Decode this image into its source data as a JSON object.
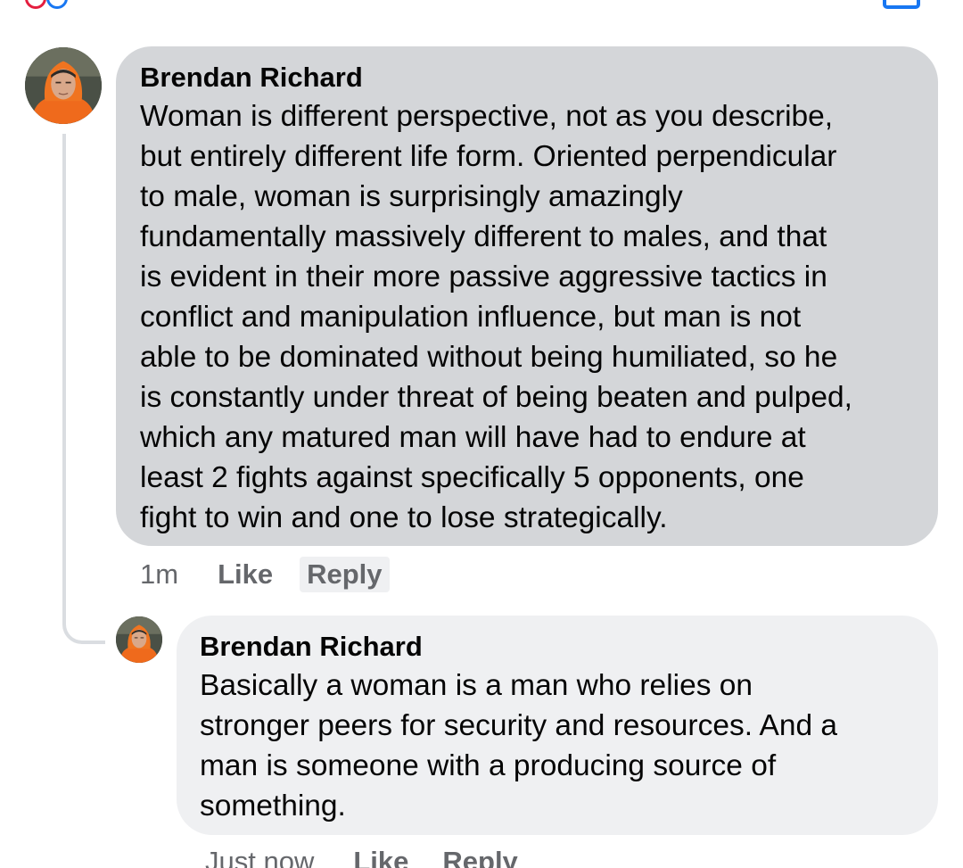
{
  "comments": [
    {
      "author": "Brendan Richard",
      "text": "Woman is different perspective, not as you describe,\nbut entirely different life form. Oriented perpendicular\nto male, woman is surprisingly amazingly\nfundamentally massively different to males, and that\nis evident in their more passive aggressive tactics in\nconflict and manipulation influence, but man is not\nable to be dominated without being humiliated, so he\nis constantly under threat of being beaten and pulped,\nwhich any matured man will have had to endure at\nleast 2 fights against specifically 5 opponents, one\nfight to win and one to lose strategically.",
      "time": "1m",
      "like_label": "Like",
      "reply_label": "Reply"
    },
    {
      "author": "Brendan Richard",
      "text": "Basically a woman is a man who relies on\nstronger peers for security and resources. And a\nman is someone with a producing source of\nsomething.",
      "time": "Just now",
      "like_label": "Like",
      "reply_label": "Reply"
    }
  ],
  "icons": {
    "avatar": "profile-photo-orange-hoodie",
    "top_right": "compose-icon"
  },
  "colors": {
    "main_bubble": "#d4d6d9",
    "reply_bubble": "#eff0f2",
    "meta_text": "#65676b",
    "thread_line": "#dadde1"
  }
}
